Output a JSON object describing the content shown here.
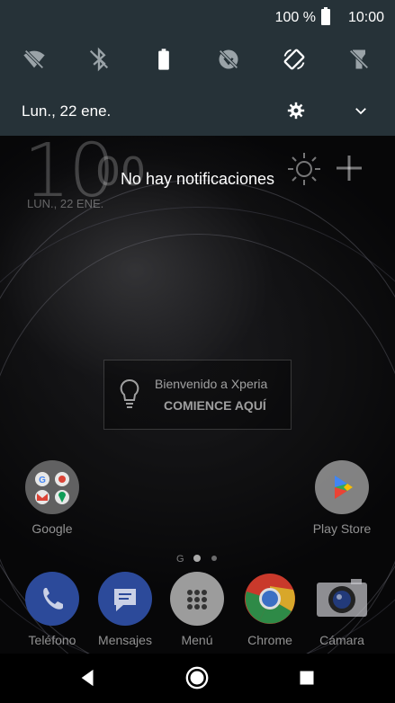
{
  "status_bar": {
    "battery_text": "100 %",
    "time": "10:00"
  },
  "quick_settings": {
    "tiles": [
      {
        "icon": "wifi-off-icon"
      },
      {
        "icon": "bluetooth-off-icon"
      },
      {
        "icon": "battery-icon"
      },
      {
        "icon": "data-saver-icon"
      },
      {
        "icon": "auto-rotate-icon"
      },
      {
        "icon": "flashlight-off-icon"
      }
    ],
    "date": "Lun., 22 ene."
  },
  "lock_widget": {
    "hour": "10",
    "minute": "00",
    "date": "LUN., 22 ENE."
  },
  "notifications": {
    "empty_text": "No hay notificaciones"
  },
  "welcome_card": {
    "line1": "Bienvenido a Xperia",
    "line2": "COMIENCE AQUÍ"
  },
  "home_apps": [
    {
      "label": "Google"
    },
    {
      "label": "Play Store"
    }
  ],
  "dock": [
    {
      "label": "Teléfono"
    },
    {
      "label": "Mensajes"
    },
    {
      "label": "Menú"
    },
    {
      "label": "Chrome"
    },
    {
      "label": "Cámara"
    }
  ],
  "page_indicator": {
    "letter": "G"
  },
  "colors": {
    "shade_bg": "#263238",
    "phone_blue": "#2c4a9a",
    "messages_blue": "#2c4a9a"
  }
}
